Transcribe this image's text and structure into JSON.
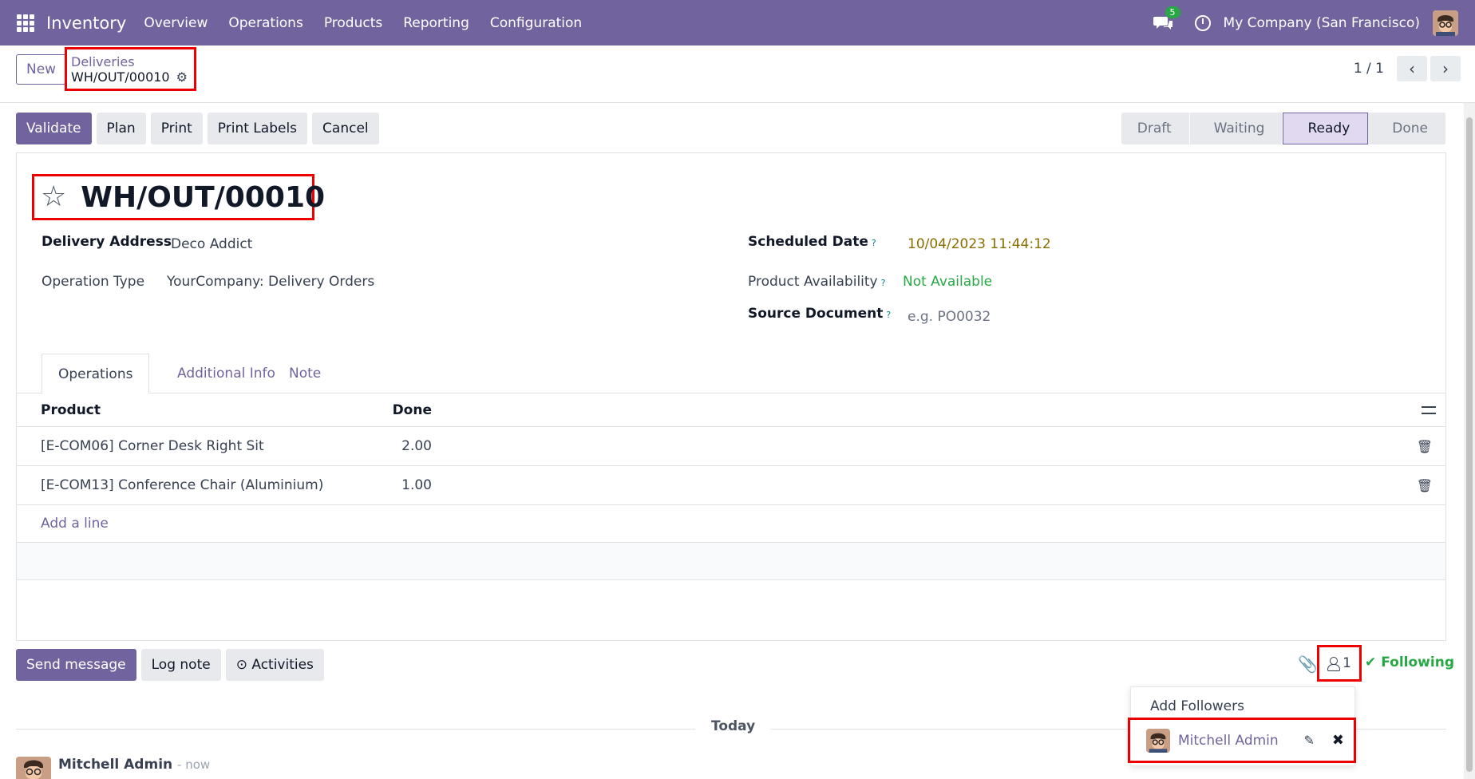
{
  "navbar": {
    "app_name": "Inventory",
    "menu": [
      "Overview",
      "Operations",
      "Products",
      "Reporting",
      "Configuration"
    ],
    "chat_badge": "5",
    "company": "My Company (San Francisco)"
  },
  "control_panel": {
    "new_label": "New",
    "breadcrumb_parent": "Deliveries",
    "breadcrumb_current": "WH/OUT/00010",
    "pager_value": "1 / 1"
  },
  "actions": {
    "validate": "Validate",
    "plan": "Plan",
    "print": "Print",
    "print_labels": "Print Labels",
    "cancel": "Cancel"
  },
  "status_stages": [
    {
      "label": "Draft",
      "active": false
    },
    {
      "label": "Waiting",
      "active": false
    },
    {
      "label": "Ready",
      "active": true
    },
    {
      "label": "Done",
      "active": false
    }
  ],
  "record": {
    "title": "WH/OUT/00010",
    "fields": {
      "delivery_address_label": "Delivery Address",
      "delivery_address_value": "Deco Addict",
      "operation_type_label": "Operation Type",
      "operation_type_value": "YourCompany: Delivery Orders",
      "scheduled_date_label": "Scheduled Date",
      "scheduled_date_value": "10/04/2023 11:44:12",
      "availability_label": "Product Availability",
      "availability_value": "Not Available",
      "source_document_label": "Source Document",
      "source_document_placeholder": "e.g. PO0032",
      "help_mark": "?"
    }
  },
  "tabs": [
    "Operations",
    "Additional Info",
    "Note"
  ],
  "table": {
    "columns": {
      "product": "Product",
      "done": "Done"
    },
    "rows": [
      {
        "product": "[E-COM06] Corner Desk Right Sit",
        "done": "2.00"
      },
      {
        "product": "[E-COM13] Conference Chair (Aluminium)",
        "done": "1.00"
      }
    ],
    "add_line": "Add a line"
  },
  "chatter": {
    "send_message": "Send message",
    "log_note": "Log note",
    "activities": "Activities",
    "followers_count": "1",
    "following": "Following",
    "today": "Today",
    "message_author": "Mitchell Admin",
    "message_time": "- now"
  },
  "followers_dropdown": {
    "add_followers": "Add Followers",
    "follower_name": "Mitchell Admin"
  },
  "colors": {
    "brand": "#71639e",
    "highlight": "#ee0000",
    "success": "#28a745"
  }
}
